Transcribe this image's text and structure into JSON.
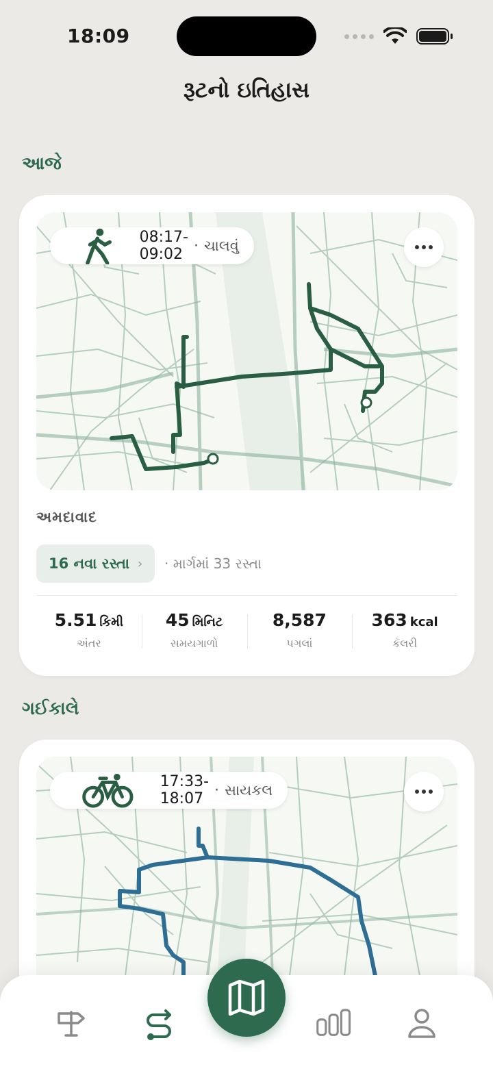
{
  "status": {
    "time": "18:09"
  },
  "page": {
    "title": "રૂટનો ઇતિહાસ"
  },
  "sections": [
    {
      "title": "આજે"
    },
    {
      "title": "ગઈકાલે"
    }
  ],
  "cards": [
    {
      "time_range": "08:17-09:02",
      "mode": "ચાલવું",
      "mode_icon": "walk-icon",
      "route_color": "#2A5E43",
      "city": "અમદાવાદ",
      "new_roads": "16 નવા રસ્તા",
      "road_count": "· માર્ગમાં 33 રસ્તા",
      "stats": [
        {
          "value": "5.51",
          "unit": "કિમી",
          "label": "અંતર"
        },
        {
          "value": "45",
          "unit": "મિનિટ",
          "label": "સમયગાળો"
        },
        {
          "value": "8,587",
          "unit": "",
          "label": "પગલાં"
        },
        {
          "value": "363",
          "unit": "kcal",
          "label": "કૅલરી"
        }
      ]
    },
    {
      "time_range": "17:33-18:07",
      "mode": "સાયકલ",
      "mode_icon": "bicycle-icon",
      "route_color": "#2E6E95"
    }
  ],
  "nav": {
    "items": [
      "signpost-icon",
      "route-icon",
      "map-icon",
      "stats-icon",
      "profile-icon"
    ],
    "active": "route-icon"
  },
  "colors": {
    "accent": "#2E6B4E",
    "background": "#ECEAE6",
    "map_road": "#8DB39C"
  }
}
